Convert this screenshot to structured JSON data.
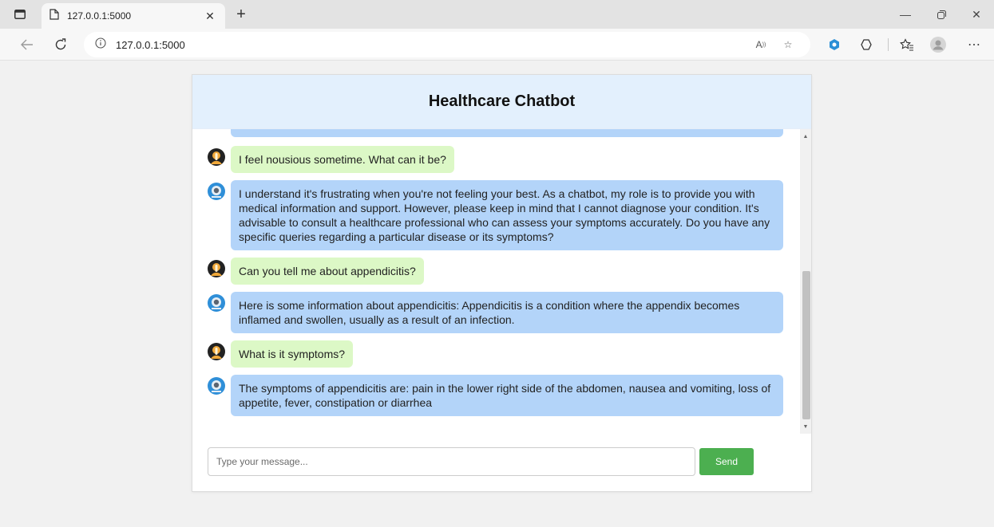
{
  "browser": {
    "tab_title": "127.0.0.1:5000",
    "url": "127.0.0.1:5000",
    "new_tab_symbol": "+",
    "icons": [
      "tab-actions-icon",
      "page-icon",
      "close-icon",
      "back-icon",
      "refresh-icon",
      "info-icon",
      "read-aloud-icon",
      "favorite-add-icon",
      "extension-icon",
      "copilot-icon",
      "favorites-icon",
      "profile-icon",
      "more-icon",
      "minimize-icon",
      "restore-icon",
      "window-close-icon"
    ]
  },
  "chat": {
    "title": "Healthcare Chatbot",
    "messages": [
      {
        "role": "bot",
        "text": ""
      },
      {
        "role": "user",
        "text": "I feel nousious sometime. What can it be?"
      },
      {
        "role": "bot",
        "text": "I understand it's frustrating when you're not feeling your best. As a chatbot, my role is to provide you with medical information and support. However, please keep in mind that I cannot diagnose your condition. It's advisable to consult a healthcare professional who can assess your symptoms accurately. Do you have any specific queries regarding a particular disease or its symptoms?"
      },
      {
        "role": "user",
        "text": "Can you tell me about appendicitis?"
      },
      {
        "role": "bot",
        "text": "Here is some information about appendicitis: Appendicitis is a condition where the appendix becomes inflamed and swollen, usually as a result of an infection."
      },
      {
        "role": "user",
        "text": "What is it symptoms?"
      },
      {
        "role": "bot",
        "text": "The symptoms of appendicitis are: pain in the lower right side of the abdomen, nausea and vomiting, loss of appetite, fever, constipation or diarrhea"
      }
    ],
    "input_placeholder": "Type your message...",
    "send_label": "Send"
  },
  "colors": {
    "header_bg": "#e3f0fd",
    "user_bubble": "#dcf8c6",
    "bot_bubble": "#b3d4f9",
    "send_button": "#4caf50"
  }
}
